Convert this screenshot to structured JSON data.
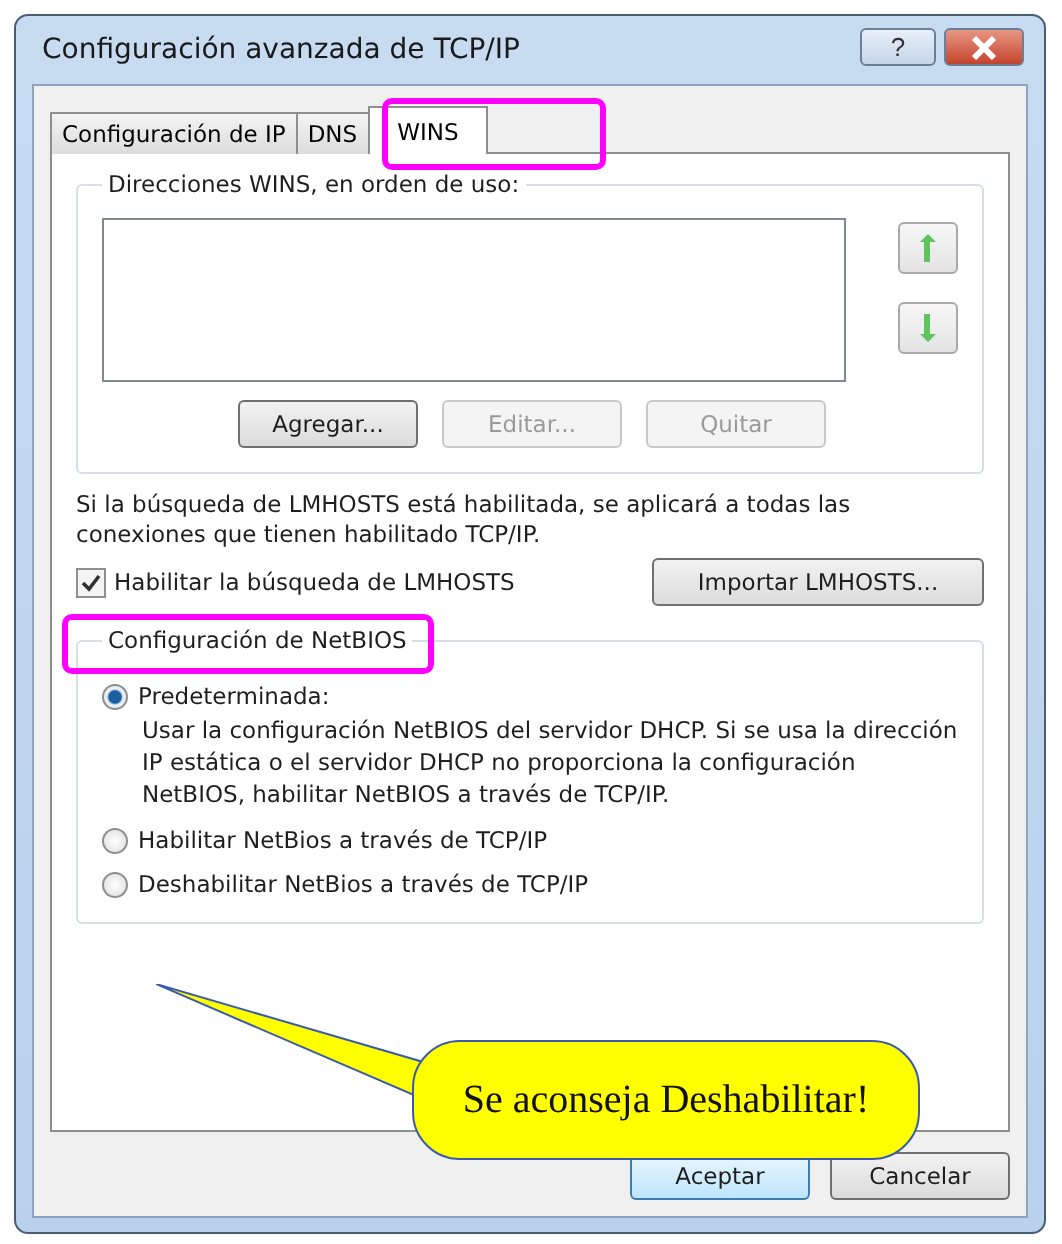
{
  "window": {
    "title": "Configuración avanzada de TCP/IP",
    "help": "?"
  },
  "tabs": [
    {
      "label": "Configuración de IP",
      "selected": false
    },
    {
      "label": "DNS",
      "selected": false
    },
    {
      "label": "WINS",
      "selected": true
    }
  ],
  "wins": {
    "legend": "Direcciones WINS, en orden de uso:",
    "buttons": [
      {
        "label": "Agregar...",
        "disabled": false
      },
      {
        "label": "Editar...",
        "disabled": true
      },
      {
        "label": "Quitar",
        "disabled": true
      }
    ]
  },
  "lmhosts": {
    "description": "Si la búsqueda de LMHOSTS está habilitada, se aplicará a todas las conexiones que tienen habilitado TCP/IP.",
    "checkbox": {
      "label": "Habilitar la búsqueda de LMHOSTS",
      "checked": true
    },
    "import_button": "Importar LMHOSTS..."
  },
  "netbios": {
    "legend": "Configuración de NetBIOS",
    "options": [
      {
        "label": "Predeterminada:",
        "selected": true,
        "description": "Usar la configuración NetBIOS del servidor DHCP. Si se usa la dirección IP estática o el servidor DHCP no proporciona la configuración NetBIOS, habilitar NetBIOS a través de TCP/IP."
      },
      {
        "label": "Habilitar NetBios a través de TCP/IP",
        "selected": false
      },
      {
        "label": "Deshabilitar NetBios a través de TCP/IP",
        "selected": false
      }
    ]
  },
  "callout": "Se aconseja Deshabilitar!",
  "footer_buttons": [
    {
      "label": "Aceptar",
      "default": true
    },
    {
      "label": "Cancelar",
      "default": false
    }
  ]
}
